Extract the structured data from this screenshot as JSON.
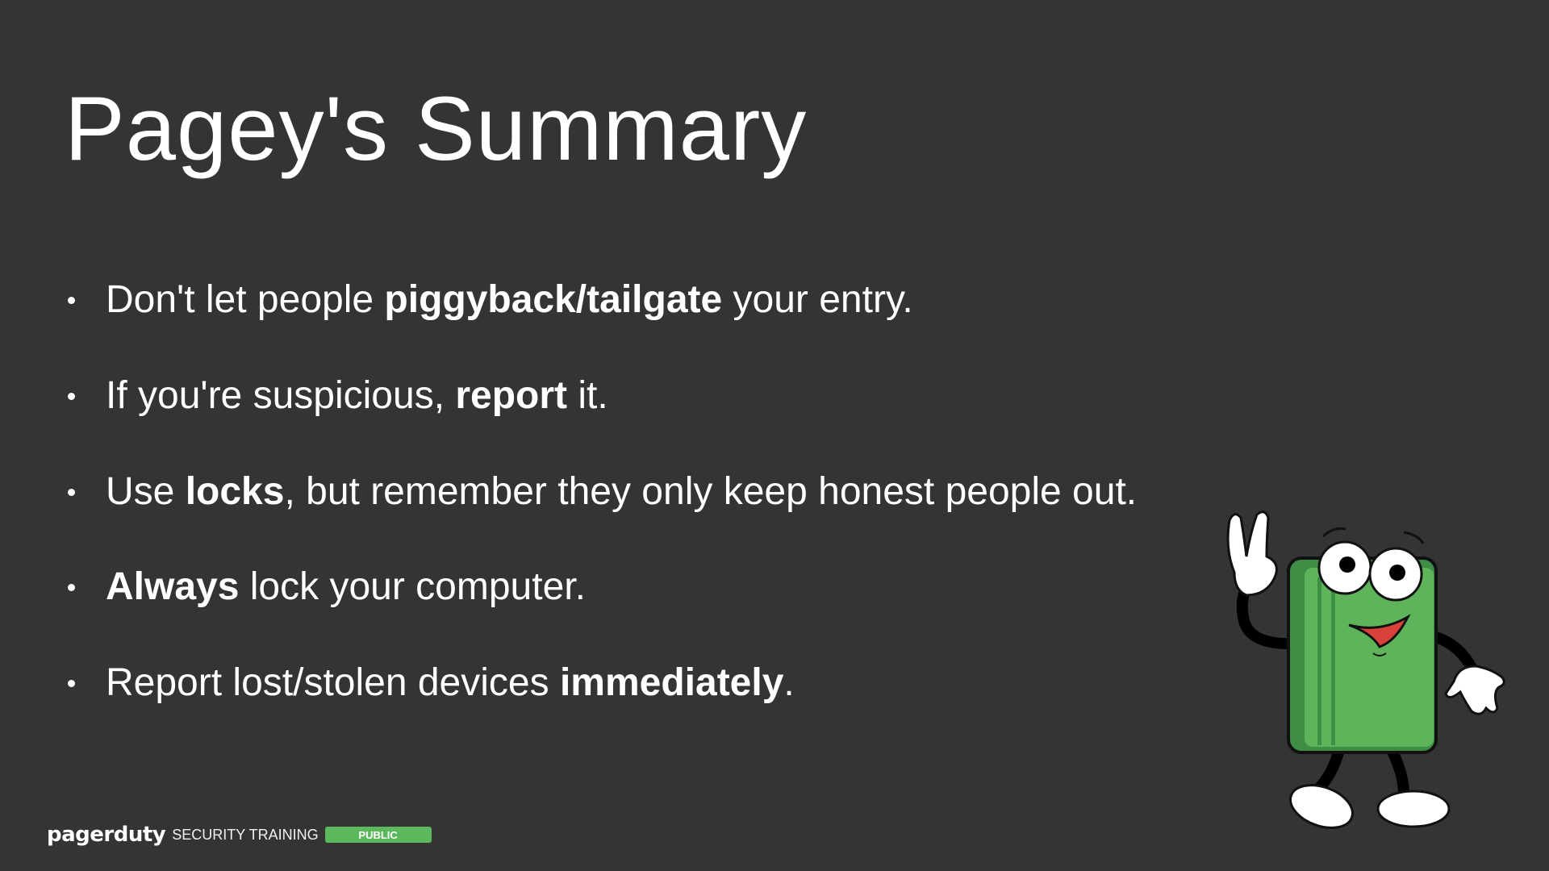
{
  "slide": {
    "title": "Pagey's Summary",
    "bullets": [
      [
        {
          "text": "Don't let people ",
          "bold": false
        },
        {
          "text": "piggyback/tailgate",
          "bold": true
        },
        {
          "text": " your entry.",
          "bold": false
        }
      ],
      [
        {
          "text": "If you're suspicious, ",
          "bold": false
        },
        {
          "text": "report",
          "bold": true
        },
        {
          "text": " it.",
          "bold": false
        }
      ],
      [
        {
          "text": "Use ",
          "bold": false
        },
        {
          "text": "locks",
          "bold": true
        },
        {
          "text": ", but remember they only keep honest people out.",
          "bold": false
        }
      ],
      [
        {
          "text": "Always",
          "bold": true
        },
        {
          "text": " lock your computer.",
          "bold": false
        }
      ],
      [
        {
          "text": "Report lost/stolen devices ",
          "bold": false
        },
        {
          "text": "immediately",
          "bold": true
        },
        {
          "text": ".",
          "bold": false
        }
      ]
    ]
  },
  "footer": {
    "logo": "pagerduty",
    "label": "SECURITY TRAINING",
    "badge": "PUBLIC"
  },
  "colors": {
    "background": "#343434",
    "badge": "#5cb85c",
    "mascot_body": "#5fb35a"
  },
  "mascot": {
    "icon": "pagey-mascot-illustration"
  }
}
